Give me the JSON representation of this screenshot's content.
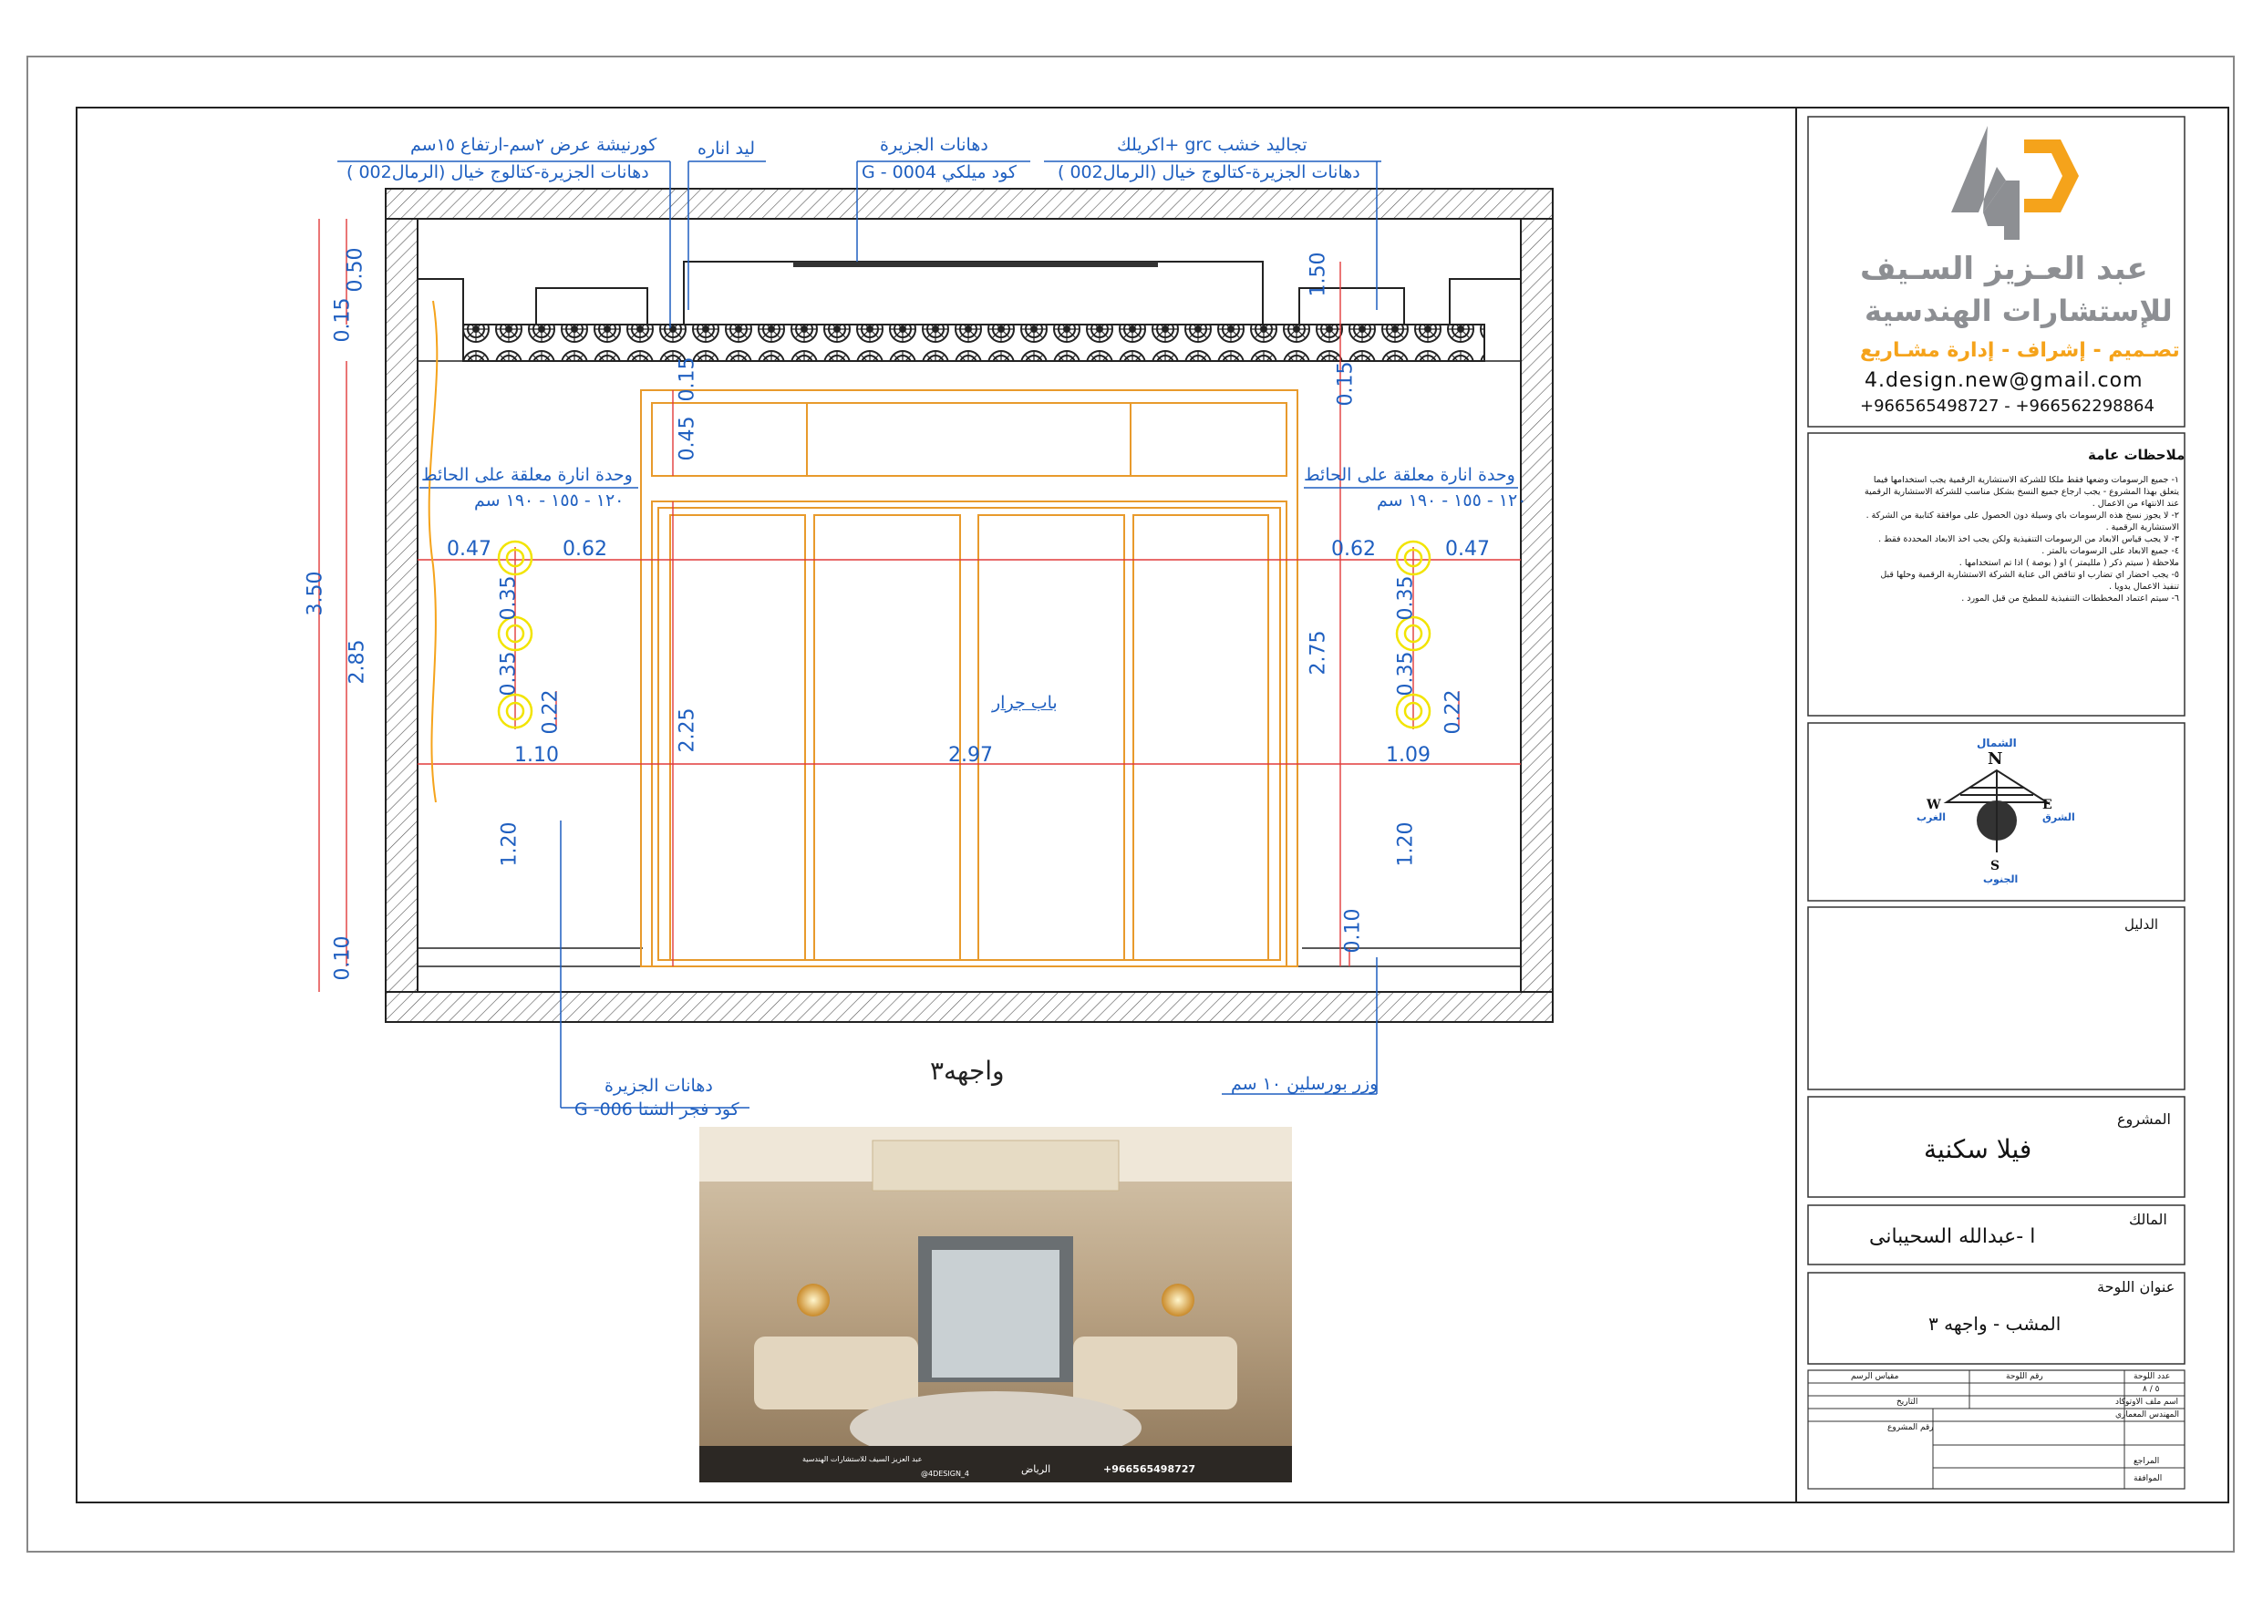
{
  "colors": {
    "dimension": "#1f5fc0",
    "door": "#e89a2c",
    "dim_line": "#e23b3b",
    "light": "#f2e400",
    "accent": "#f5a31b",
    "logo_grey": "#8d8f93"
  },
  "annotations": {
    "cornice_line1": "كورنيشة عرض ٢سم-ارتفاع ١٥سم",
    "cornice_line2": "دهانات الجزيرة-كتالوج خيال (الرمال002 )",
    "led": "ليد اناره",
    "paint_top_line1": "دهانات الجزيرة",
    "paint_top_line2": "كود ميلكي  G - 0004",
    "wood_line1": "تجاليد خشب grc +اكريلك",
    "wood_line2": "دهانات الجزيرة-كتالوج خيال (الرمال002 )",
    "lamp_left_line1": "وحدة انارة معلقة على الحائط",
    "lamp_left_line2": "١٢٠ - ١٥٥ - ١٩٠ سم",
    "lamp_right_line1": "وحدة انارة معلقة على الحائط",
    "lamp_right_line2": "١٢٠ - ١٥٥ - ١٩٠ سم",
    "sliding_door": "باب جرار",
    "paint_bottom_line1": "دهانات الجزيرة",
    "paint_bottom_line2": "كود فجر الشتا G -006",
    "elevation_title": "واجهه٣",
    "skirting": "وزر بورسلين ١٠ سم"
  },
  "dimensions": {
    "d350": "3.50",
    "d285": "2.85",
    "d015a": "0.15",
    "d050a": "0.50",
    "d010a": "0.10",
    "d047a": "0.47",
    "d062a": "0.62",
    "d035a": "0.35",
    "d035b": "0.35",
    "d022a": "0.22",
    "d110": "1.10",
    "d120a": "1.20",
    "d015b": "0.15",
    "d045": "0.45",
    "d225": "2.25",
    "d297": "2.97",
    "d050b": "1.50",
    "d015c": "0.15",
    "d275": "2.75",
    "d062b": "0.62",
    "d047b": "0.47",
    "d035c": "0.35",
    "d035d": "0.35",
    "d022b": "0.22",
    "d109": "1.09",
    "d120b": "1.20",
    "d010b": "0.10"
  },
  "title_block": {
    "company_line1": "عبد العـزيز السـيف",
    "company_line2": "للإستشارات الهندسية",
    "services": "تصـميم - إشراف - إدارة مشـاريع",
    "email": "4.design.new@gmail.com",
    "phones": "+966565498727  -  +966562298864",
    "notes_title": "ملاحظات عامة",
    "notes": [
      "١- جميع الرسومات وضعها فقط ملكا للشركة الاستشارية الرقمية يجب استخدامها فيما",
      "يتعلق بهذا المشروع - يجب ارجاع جميع النسخ بشكل مناسب للشركة الاستشارية الرقمية",
      "عند الانتهاء من الاعمال .",
      "٢- لا يجوز نسخ هذه الرسومات باي وسيلة دون الحصول على موافقة كتابية من الشركة .",
      "الاستشارية الرقمية .",
      "٣- لا يجب قياس الابعاد من الرسومات التنفيذية ولكن يجب اخذ الابعاد المحددة فقط .",
      "٤- جميع الابعاد على الرسومات بالمتر .",
      "ملاحظة ( سيتم ذكر ( ملليمتر ) او ( بوصة ) اذا تم استخدامها .",
      "٥- يجب احضار اي تضارب او تناقض الى عناية الشركة الاستشارية الرقمية وحلها قبل",
      "تنفيذ الاعمال يدويا .",
      "٦- سيتم اعتماد المخططات التنفيذية للمطبخ من قبل المورد ."
    ],
    "compass_n": "N",
    "compass_s": "S",
    "compass_e": "E",
    "compass_w": "W",
    "compass_n_ar": "الشمال",
    "compass_s_ar": "الجنوب",
    "compass_e_ar": "الشرق",
    "compass_w_ar": "الغرب",
    "guide_label": "الدليل",
    "project_label": "المشروع",
    "project_value": "فيلا سكنية",
    "owner_label": "المالك",
    "owner_value": "ا -عبدالله السحيبانى",
    "sheet_title_label": "عنوان اللوحة",
    "sheet_title_value": "المشب - واجهه ٣",
    "table": {
      "sheet_count": "عدد اللوحة",
      "sheet_no": "رقم اللوحة",
      "scale": "مقياس الرسم",
      "page": "٥ / ٨",
      "file_name": "اسم ملف الاوتوكاد",
      "date": "التاريخ",
      "engineer": "المهندس المعماري",
      "project_no": "رقم المشروع",
      "review": "المراجع",
      "approval": "الموافقة"
    }
  },
  "render_caption": {
    "company": "عبد العزيز السيف للاستشارات الهندسية",
    "handle": "@4DESIGN_4",
    "city": "الرياض",
    "phone": "+966565498727"
  }
}
